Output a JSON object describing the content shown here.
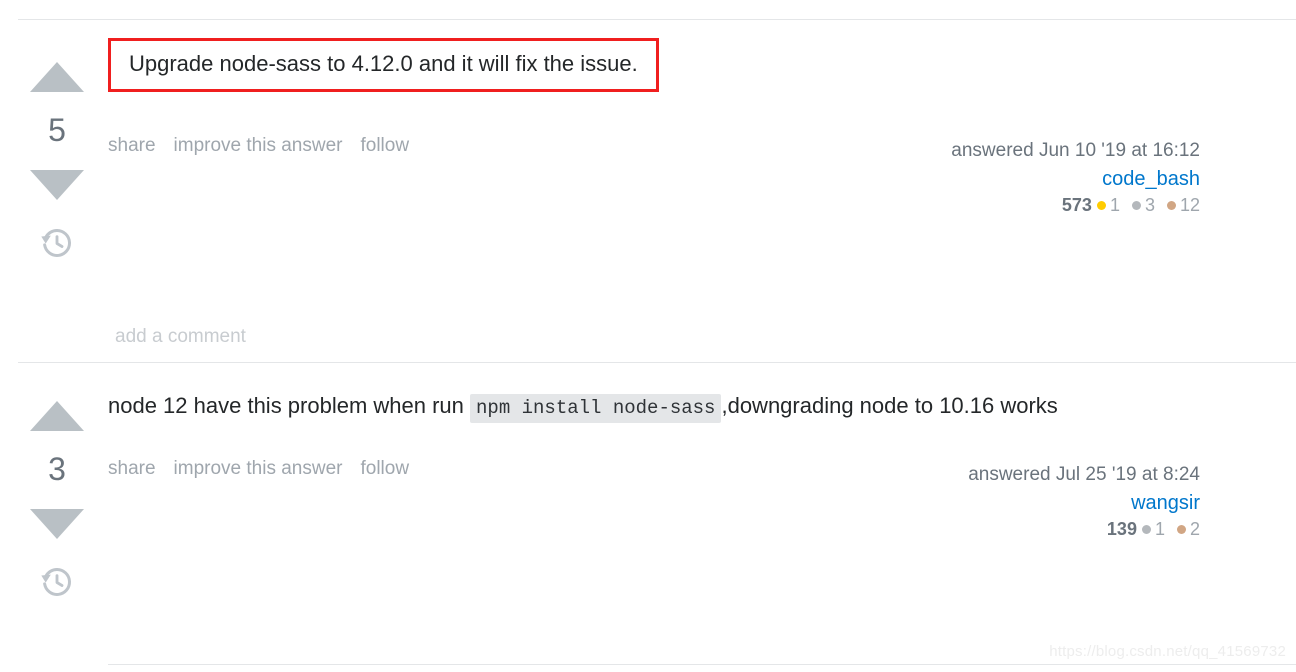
{
  "watermark": "https://blog.csdn.net/qq_41569732",
  "answers": [
    {
      "score": "5",
      "body_prefix": "Upgrade node-sass to 4.12.0 and it will fix the issue.",
      "highlighted": true,
      "actions": {
        "share": "share",
        "improve": "improve this answer",
        "follow": "follow"
      },
      "add_comment": "add a comment",
      "user": {
        "answered": "answered Jun 10 '19 at 16:12",
        "name": "code_bash",
        "reputation": "573",
        "badges": [
          {
            "type": "gold",
            "color": "#ffcc01",
            "count": "1"
          },
          {
            "type": "silver",
            "color": "#b4b8bc",
            "count": "3"
          },
          {
            "type": "bronze",
            "color": "#d1a684",
            "count": "12"
          }
        ]
      },
      "icons": {
        "upvote": "arrow-up-icon",
        "downvote": "arrow-down-icon",
        "history": "history-icon"
      }
    },
    {
      "score": "3",
      "body_prefix": "node 12 have this problem when run ",
      "body_code": "npm install node-sass",
      "body_suffix": ",downgrading node to 10.16 works",
      "highlighted": false,
      "actions": {
        "share": "share",
        "improve": "improve this answer",
        "follow": "follow"
      },
      "user": {
        "answered": "answered Jul 25 '19 at 8:24",
        "name": "wangsir",
        "reputation": "139",
        "badges": [
          {
            "type": "silver",
            "color": "#b4b8bc",
            "count": "1"
          },
          {
            "type": "bronze",
            "color": "#d1a684",
            "count": "2"
          }
        ]
      },
      "icons": {
        "upvote": "arrow-up-icon",
        "downvote": "arrow-down-icon",
        "history": "history-icon"
      }
    }
  ],
  "colors": {
    "link": "#0077cc",
    "muted": "#9fa6ad",
    "text": "#242729",
    "highlight_border": "#f01f1f",
    "vote_arrow": "#b9c0c5",
    "rule": "#e4e6e8"
  }
}
